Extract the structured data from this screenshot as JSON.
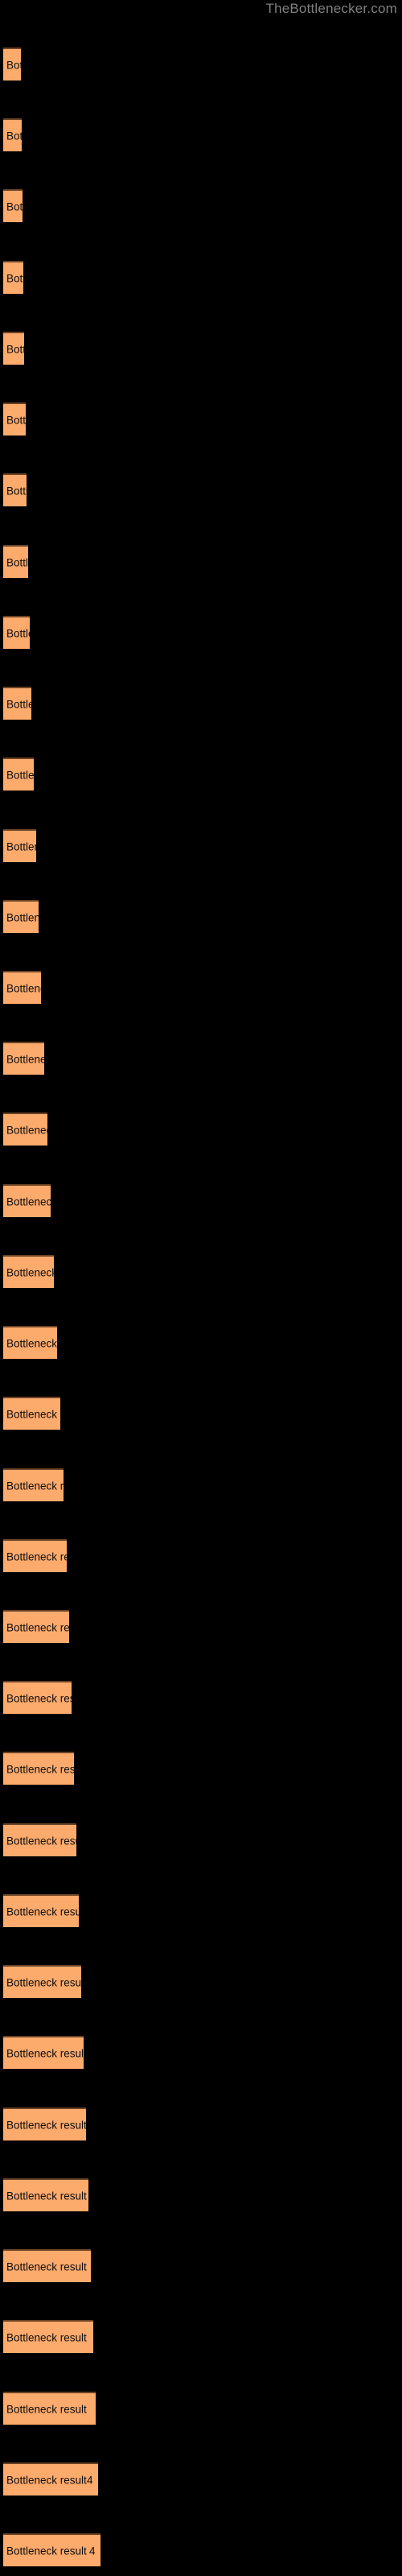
{
  "watermark": "TheBottlenecker.com",
  "chart_data": {
    "type": "bar",
    "orientation": "horizontal",
    "title": "",
    "subtitle": "",
    "xlabel": "",
    "ylabel": "",
    "grid": false,
    "legend": null,
    "background_color": "#000000",
    "bar_color": "#fdaa6d",
    "bar_border_color": "#6b4325",
    "label_color": "#0d0d0d",
    "watermark_color": "#808080",
    "xlim": [
      0,
      100
    ],
    "categories": [
      "Bottleneck result",
      "Bottleneck result",
      "Bottleneck result",
      "Bottleneck result",
      "Bottleneck result",
      "Bottleneck result",
      "Bottleneck result",
      "Bottleneck result",
      "Bottleneck result",
      "Bottleneck result",
      "Bottleneck result",
      "Bottleneck result",
      "Bottleneck result",
      "Bottleneck result",
      "Bottleneck result",
      "Bottleneck result",
      "Bottleneck result",
      "Bottleneck result",
      "Bottleneck result",
      "Bottleneck result",
      "Bottleneck result",
      "Bottleneck result",
      "Bottleneck result",
      "Bottleneck result",
      "Bottleneck result",
      "Bottleneck result",
      "Bottleneck result",
      "Bottleneck result",
      "Bottleneck result",
      "Bottleneck result",
      "Bottleneck result",
      "Bottleneck result",
      "Bottleneck result",
      "Bottleneck result",
      "Bottleneck result",
      "Bottleneck result"
    ],
    "values": [
      17,
      18,
      19,
      20,
      21,
      23,
      24,
      25,
      26,
      28,
      30,
      33,
      35,
      37,
      40,
      43,
      47,
      50,
      53,
      56,
      59,
      62,
      64,
      66,
      68,
      70,
      72,
      74,
      76,
      78,
      81,
      84,
      87,
      90,
      94,
      98
    ],
    "bar_pixel_widths": [
      22,
      23,
      24,
      25,
      26,
      28,
      29,
      31,
      33,
      35,
      38,
      41,
      44,
      47,
      51,
      55,
      59,
      63,
      67,
      71,
      75,
      79,
      82,
      85,
      88,
      91,
      94,
      97,
      100,
      103,
      106,
      109,
      112,
      115,
      118,
      121
    ],
    "bar_top_positions": [
      59,
      145,
      200,
      244,
      287,
      330,
      373,
      417,
      460,
      504,
      547,
      590,
      634,
      677,
      720,
      764,
      807,
      850,
      894,
      937,
      980,
      1024,
      1067,
      1110,
      1154,
      1197,
      1240,
      1284,
      1327,
      1370,
      1414,
      1457,
      1500,
      1544,
      1587,
      1630
    ],
    "value_labels": [
      "",
      "",
      "",
      "",
      "",
      "",
      "",
      "",
      "",
      "",
      "",
      "",
      "",
      "",
      "",
      "",
      "",
      "",
      "",
      "",
      "",
      "",
      "",
      "",
      "",
      "",
      "",
      "",
      "",
      "",
      "",
      "",
      "",
      "",
      "4",
      "4"
    ]
  }
}
